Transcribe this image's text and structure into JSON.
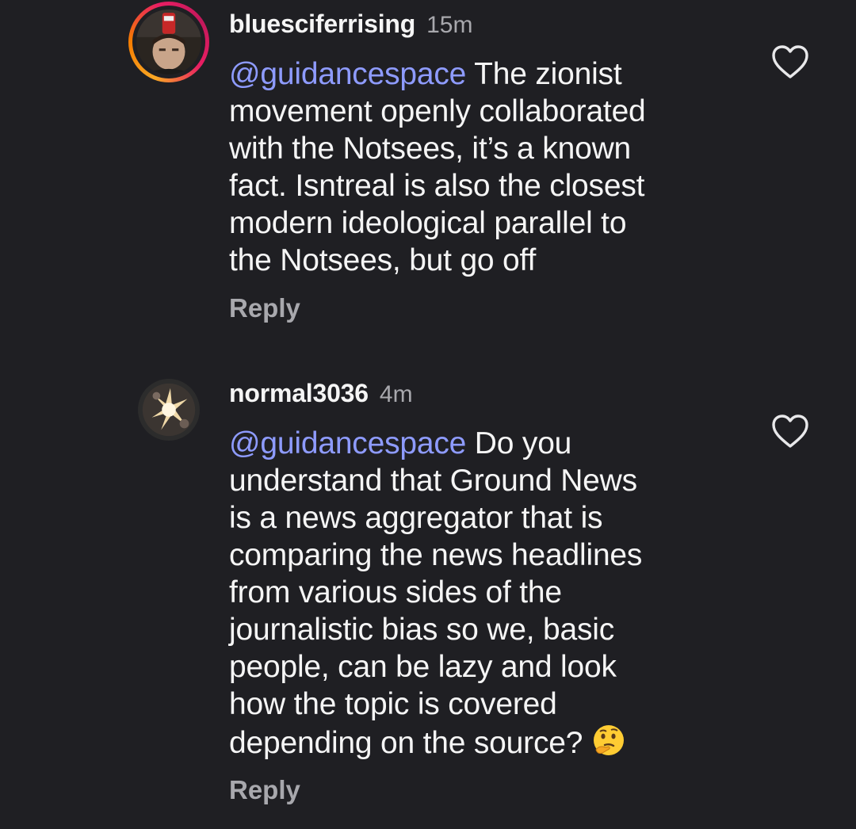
{
  "comments": [
    {
      "username": "bluesciferrising",
      "time": "15m",
      "mention": "@guidancespace",
      "text_lines": [
        " The zionist",
        "movement openly collaborated",
        "with the Notsees, it’s a known",
        "fact. Isntreal is also the closest",
        "modern ideological parallel to",
        "the Notsees, but go off"
      ],
      "reply_label": "Reply",
      "avatar_icon": "profile-photo",
      "has_story_ring": true
    },
    {
      "username": "normal3036",
      "time": "4m",
      "mention": "@guidancespace",
      "text_lines": [
        " Do you",
        "understand that Ground News",
        "is a news aggregator that is",
        "comparing the news headlines",
        "from various sides of the",
        "journalistic bias so we, basic",
        "people, can be lazy and look",
        "how the topic is covered",
        "depending on the source? "
      ],
      "emoji": "thinking-face-emoji",
      "reply_label": "Reply",
      "avatar_icon": "profile-photo",
      "has_story_ring": false
    }
  ],
  "colors": {
    "background": "#1f1f23",
    "mention": "#8e9bff",
    "secondary_text": "#a8a8ad"
  },
  "icons": {
    "like": "heart-outline-icon"
  }
}
